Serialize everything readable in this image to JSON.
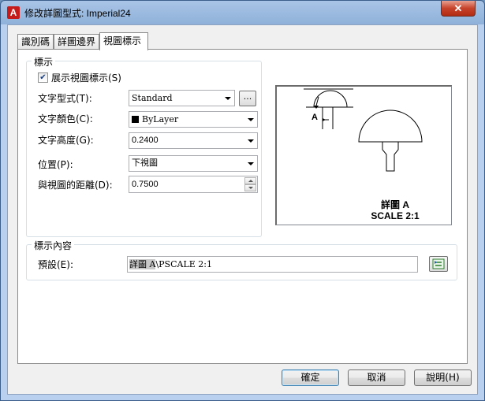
{
  "window": {
    "title": "修改詳圖型式: Imperial24",
    "app_icon": "A",
    "close_glyph": "✕"
  },
  "tabs": [
    {
      "label": "識別碼",
      "active": false
    },
    {
      "label": "詳圖邊界",
      "active": false
    },
    {
      "label": "視圖標示",
      "active": true
    }
  ],
  "label_group": {
    "title": "標示",
    "show_checkbox": {
      "label": "展示視圖標示(S)",
      "checked": true
    },
    "text_style": {
      "label": "文字型式(T):",
      "value": "Standard",
      "browse_label": "..."
    },
    "text_color": {
      "label": "文字顏色(C):",
      "value": "ByLayer"
    },
    "text_height": {
      "label": "文字高度(G):",
      "value": "0.2400"
    },
    "position": {
      "label": "位置(P):",
      "value": "下視圖"
    },
    "offset": {
      "label": "與視圖的距離(D):",
      "value": "0.7500"
    }
  },
  "preview": {
    "marker_letter": "A",
    "caption_line1": "詳圖 A",
    "caption_line2": "SCALE 2:1"
  },
  "content_group": {
    "title": "標示內容",
    "default": {
      "label": "預設(E):",
      "value_part1": "詳圖 ",
      "value_part2": "A",
      "value_part3": "\\PSCALE 2:1"
    }
  },
  "buttons": {
    "ok": "確定",
    "cancel": "取消",
    "help": "說明(H)"
  },
  "colors": {
    "title_gradient_top": "#a9c4e6",
    "close_red": "#c7432b",
    "default_button_border": "#3c7fb1",
    "insert_field_icon": "#2d7d2d"
  }
}
